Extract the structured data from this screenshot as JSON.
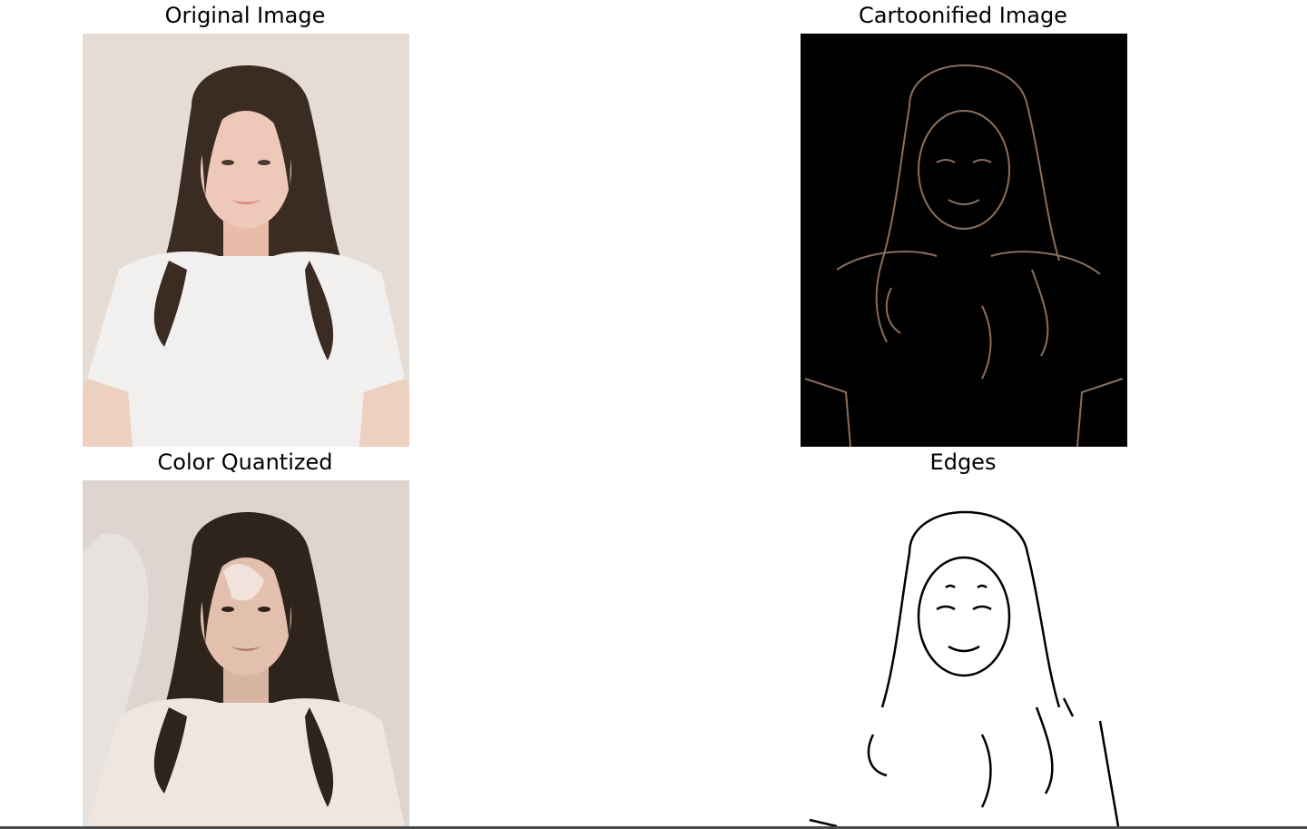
{
  "figure": {
    "panels": [
      {
        "title": "Original Image"
      },
      {
        "title": "Cartoonified Image"
      },
      {
        "title": "Color Quantized"
      },
      {
        "title": "Edges"
      }
    ]
  },
  "colors": {
    "original_background": "#e6dcd6",
    "hair": "#3a2c22",
    "skin": "#eec8b8",
    "shirt": "#f2f0ee",
    "cartoon_background": "#000000",
    "cartoon_lines": "#8a6e5c",
    "quantized_background": "#dfd5d0",
    "quantized_hair": "#2e241b",
    "edges_background": "#ffffff",
    "edges_lines": "#000000"
  }
}
